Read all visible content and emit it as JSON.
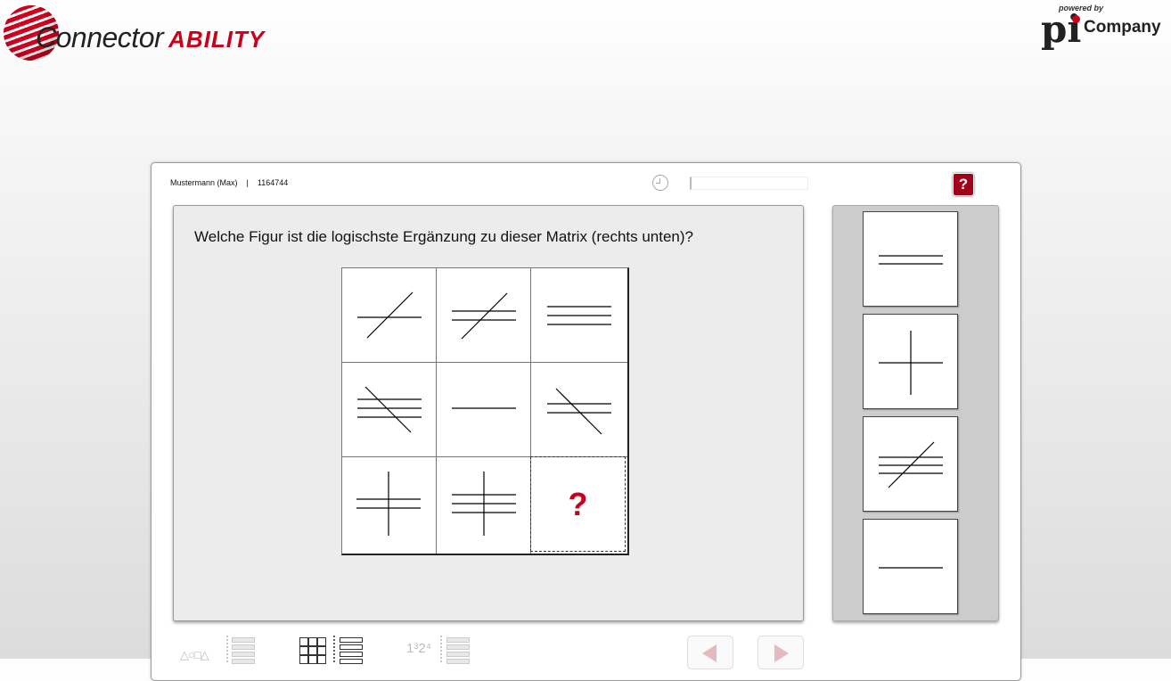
{
  "brand": {
    "left_logo_text": "Connector",
    "left_logo_accent": "ABILITY",
    "right_powered": "powered by",
    "right_pi": "pi",
    "right_company": "Company",
    "accent_color": "#c8001a"
  },
  "header": {
    "user_name": "Mustermann (Max)",
    "separator": "|",
    "user_id": "1164744",
    "help_label": "?"
  },
  "question": {
    "text": "Welche Figur ist die logischste Ergänzung zu dieser Matrix (rechts unten)?",
    "missing_marker": "?"
  },
  "matrix": {
    "cells": [
      {
        "row": 1,
        "col": 1,
        "horizontal_lines": 1,
        "extra": "diagonal-up"
      },
      {
        "row": 1,
        "col": 2,
        "horizontal_lines": 2,
        "extra": "diagonal-up"
      },
      {
        "row": 1,
        "col": 3,
        "horizontal_lines": 3,
        "extra": "none"
      },
      {
        "row": 2,
        "col": 1,
        "horizontal_lines": 3,
        "extra": "diagonal-down"
      },
      {
        "row": 2,
        "col": 2,
        "horizontal_lines": 1,
        "extra": "none"
      },
      {
        "row": 2,
        "col": 3,
        "horizontal_lines": 2,
        "extra": "diagonal-down"
      },
      {
        "row": 3,
        "col": 1,
        "horizontal_lines": 2,
        "extra": "vertical"
      },
      {
        "row": 3,
        "col": 2,
        "horizontal_lines": 3,
        "extra": "vertical"
      },
      {
        "row": 3,
        "col": 3,
        "horizontal_lines": 0,
        "extra": "missing"
      }
    ]
  },
  "answers": [
    {
      "option": 1,
      "horizontal_lines": 2,
      "extra": "none"
    },
    {
      "option": 2,
      "horizontal_lines": 1,
      "extra": "vertical"
    },
    {
      "option": 3,
      "horizontal_lines": 3,
      "extra": "diagonal-up"
    },
    {
      "option": 4,
      "horizontal_lines": 1,
      "extra": "none"
    }
  ],
  "toolbar": {
    "shapes_label": "△○□△",
    "order_label": "1³2⁴"
  },
  "icons": [
    "clock-icon",
    "help-icon",
    "shapes-icon",
    "list-icon",
    "grid-icon",
    "order-icon",
    "arrow-left-icon",
    "arrow-right-icon"
  ]
}
